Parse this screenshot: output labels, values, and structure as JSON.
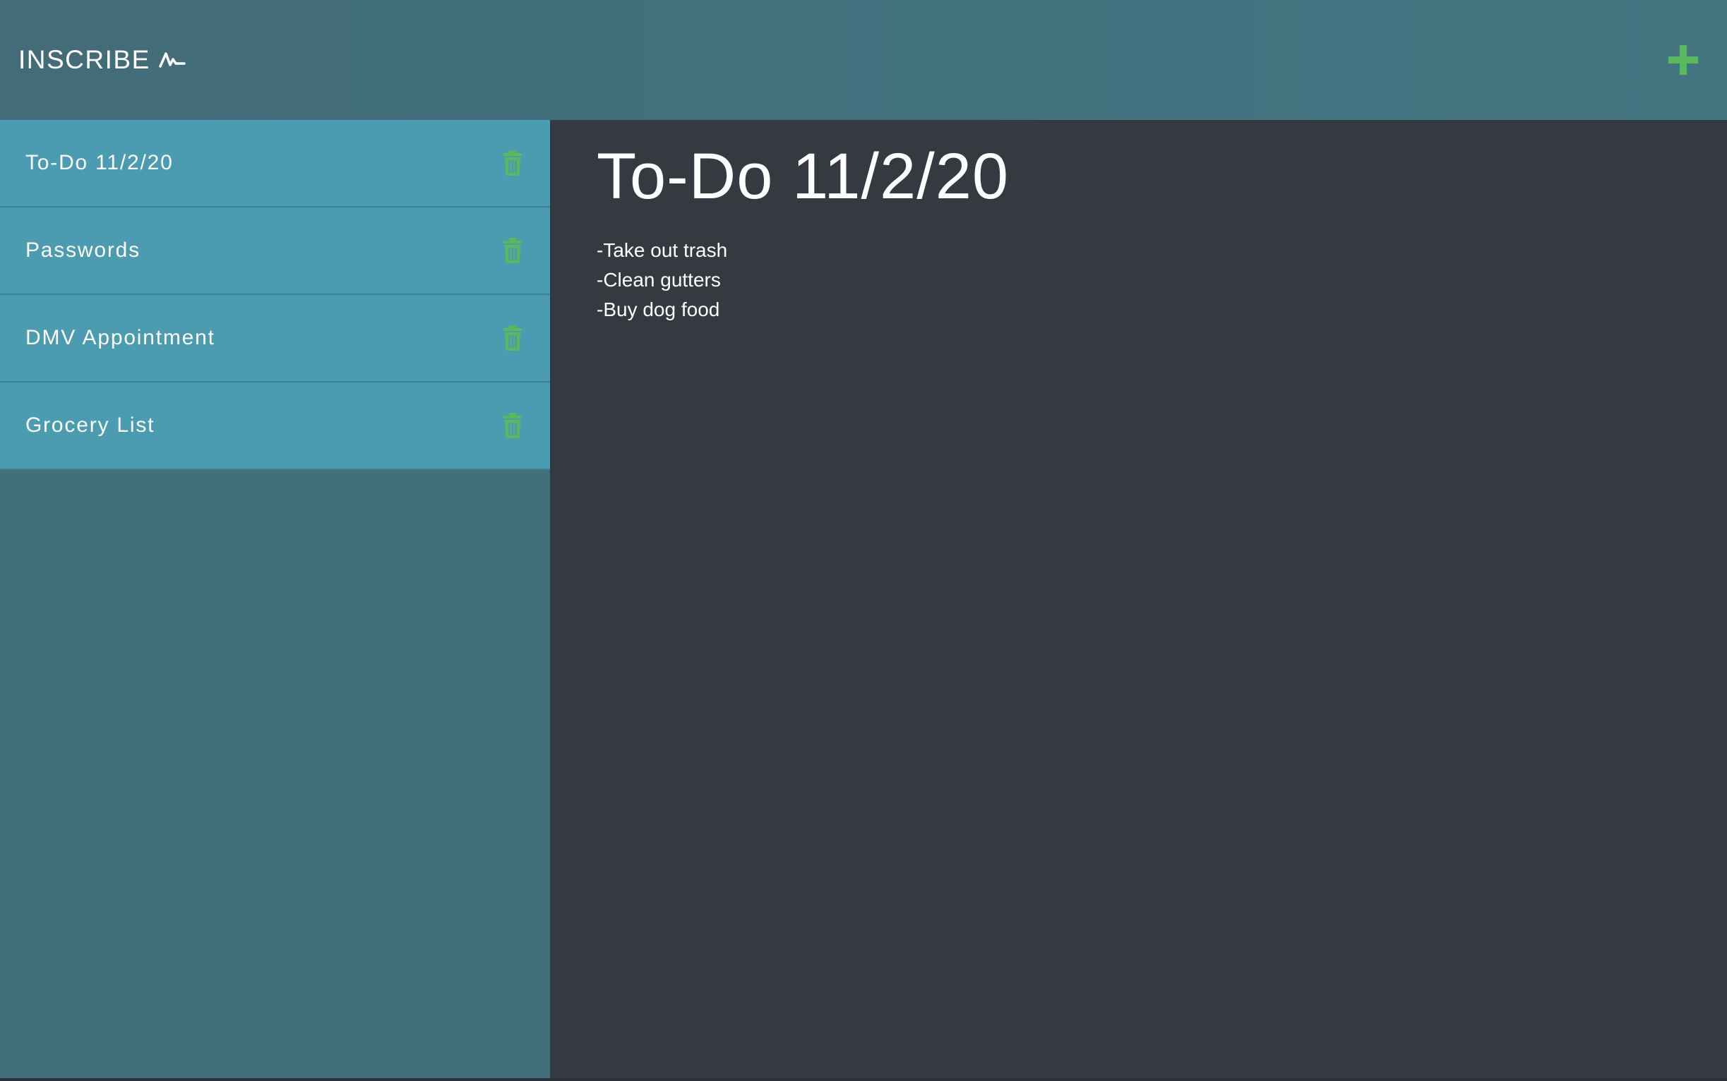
{
  "header": {
    "brand": "INSCRIBE",
    "brand_icon": "pulse-signature-icon",
    "add_icon": "plus-icon",
    "accent_color": "#5cb85c"
  },
  "sidebar": {
    "items": [
      {
        "label": "To-Do 11/2/20",
        "icon": "trash-icon"
      },
      {
        "label": "Passwords",
        "icon": "trash-icon"
      },
      {
        "label": "DMV Appointment",
        "icon": "trash-icon"
      },
      {
        "label": "Grocery List",
        "icon": "trash-icon"
      }
    ]
  },
  "main": {
    "title": "To-Do 11/2/20",
    "lines": [
      "-Take out trash",
      "-Clean gutters",
      "-Buy dog food"
    ]
  }
}
